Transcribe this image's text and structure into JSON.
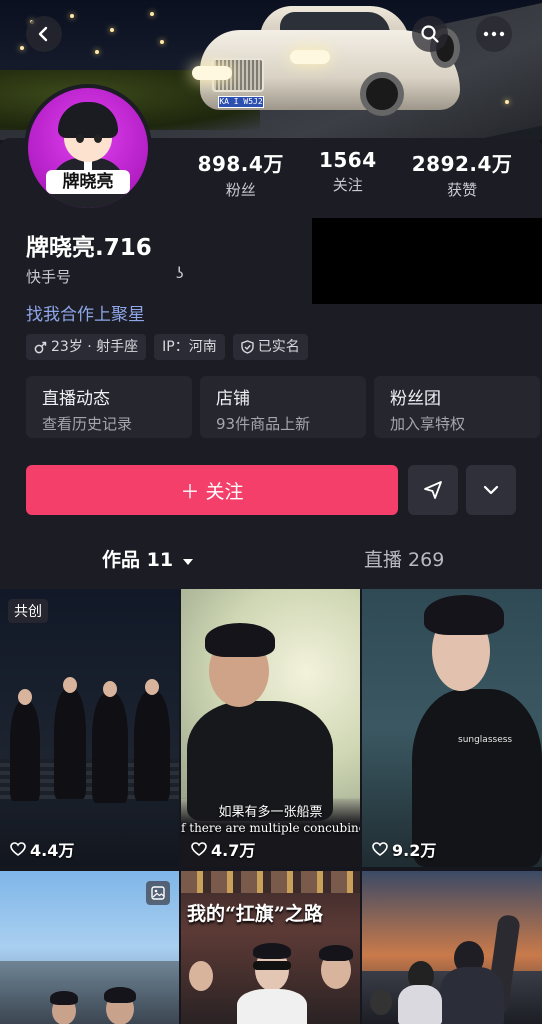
{
  "cover": {
    "plate_text": "KA I W5J2"
  },
  "topbar": {
    "back_icon": "chevron-left-icon",
    "search_icon": "search-icon",
    "more_icon": "more-dots-icon"
  },
  "profile": {
    "avatar_name": "牌晓亮",
    "username": "牌晓亮.716",
    "kuaishou_label": "快手号",
    "kuaishou_value": "ʖ",
    "coop_link": "找我合作上聚星",
    "stats": [
      {
        "value": "898.4万",
        "label": "粉丝"
      },
      {
        "value": "1564",
        "label": "关注"
      },
      {
        "value": "2892.4万",
        "label": "获赞"
      }
    ],
    "tags": {
      "age": "23岁 · 射手座",
      "ip": "IP：河南",
      "verified": "已实名"
    },
    "cards": [
      {
        "title": "直播动态",
        "subtitle": "查看历史记录"
      },
      {
        "title": "店铺",
        "subtitle": "93件商品上新"
      },
      {
        "title": "粉丝团",
        "subtitle": "加入享特权"
      }
    ],
    "follow_label": "＋ 关注"
  },
  "tabs": {
    "works": "作品 11",
    "live": "直播 269"
  },
  "grid": [
    {
      "likes": "4.4万",
      "badge": "共创"
    },
    {
      "likes": "4.7万",
      "caption_cn": "如果有多一张船票",
      "caption_en": "f there are multiple concubine"
    },
    {
      "likes": "9.2万",
      "overlay_text": "sunglassess"
    },
    {
      "badge_icon": "image-icon"
    },
    {
      "title_text": "我的“扛旗”之路"
    },
    {}
  ],
  "colors": {
    "accent": "#f33f6a",
    "link": "#8ea6e8",
    "panel": "#1c1c24"
  }
}
